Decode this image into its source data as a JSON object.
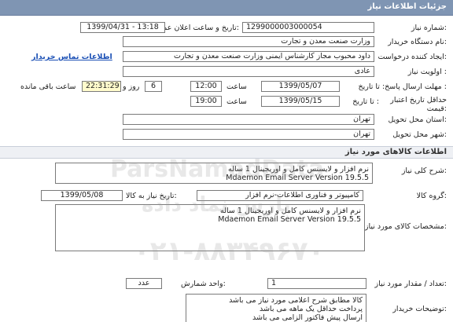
{
  "header": {
    "title": "جزئیات اطلاعات نیاز"
  },
  "need": {
    "number_label": "شماره نیاز:",
    "number_value": "1299000003000054",
    "announce_label": "تاریخ و ساعت اعلان عمومی:",
    "announce_value": "1399/04/31 - 13:18",
    "buyer_label": "نام دستگاه خریدار:",
    "buyer_value": "وزارت صنعت معدن و تجارت",
    "creator_label": "ایجاد کننده درخواست:",
    "creator_value": "داود محبوب مجاز کارشناس ایمنی وزارت صنعت معدن و تجارت",
    "contact_link": "اطلاعات تماس خریدار",
    "priority_label": "اولویت نیاز :",
    "priority_value": "عادی",
    "deadline_label": "مهلت ارسال پاسخ: تا تاریخ :",
    "deadline_date": "1399/05/07",
    "time_label": "ساعت",
    "deadline_time": "12:00",
    "days_value": "6",
    "days_label": "روز و",
    "remaining_time": "22:31:29",
    "remaining_label": "ساعت باقی مانده",
    "validity_label": "حداقل تاریخ اعتبار قیمت:",
    "validity_prefix": "تا تاریخ :",
    "validity_date": "1399/05/15",
    "validity_time_label": "ساعت",
    "validity_time": "19:00",
    "province_label": "استان محل تحویل:",
    "province_value": "تهران",
    "city_label": "شهر محل تحویل:",
    "city_value": "تهران"
  },
  "goods": {
    "section_title": "اطلاعات کالاهای مورد نیاز",
    "summary_label": "شرح کلی نیاز:",
    "summary_line1": "نرم افزار و لایسنس کامل و اوریجینال 1 ساله",
    "summary_line2": "Mdaemon Email Server Version 19.5.5",
    "group_label": "گروه کالا:",
    "group_value": "کامپیوتر و فناوری اطلاعات-نرم افزار",
    "need_date_label": "تاریخ نیاز به کالا:",
    "need_date_value": "1399/05/08",
    "spec_label": "مشخصات کالای مورد نیاز:",
    "spec_line1": "نرم افزار و لایسنس کامل و اوریجینال 1 ساله",
    "spec_line2": "Mdaemon Email Server Version 19.5.5",
    "qty_label": "تعداد / مقدار مورد نیاز:",
    "qty_value": "1",
    "unit_label": "واحد شمارش:",
    "unit_value": "عدد",
    "buyer_notes_label": "توضیحات خریدار:",
    "notes_line1": "کالا مطابق شرح اعلامی مورد نیاز می باشد",
    "notes_line2": "پرداخت حداقل یک ماهه می باشد",
    "notes_line3": "ارسال پیش فاکتور الزامی می باشد"
  },
  "watermark": {
    "line1": "ParsNamadData",
    "line2": "پارس نماد داده",
    "line3": "۰۲۱-۸۸۳۴۹۶۷۰"
  }
}
